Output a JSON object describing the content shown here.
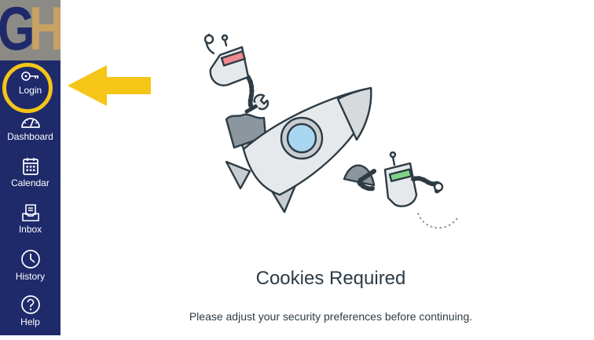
{
  "logo": {
    "letter_1": "G",
    "letter_2": "H"
  },
  "sidebar": {
    "items": [
      {
        "label": "Login",
        "icon": "key-icon"
      },
      {
        "label": "Dashboard",
        "icon": "dashboard-gauge-icon"
      },
      {
        "label": "Calendar",
        "icon": "calendar-icon"
      },
      {
        "label": "Inbox",
        "icon": "inbox-icon"
      },
      {
        "label": "History",
        "icon": "clock-icon"
      },
      {
        "label": "Help",
        "icon": "help-icon"
      }
    ],
    "highlight_color": "#f5c518",
    "background_color": "#1f2a6b"
  },
  "annotation": {
    "arrow_color": "#f5c518"
  },
  "main": {
    "title": "Cookies Required",
    "message": "Please adjust your security preferences before continuing."
  }
}
